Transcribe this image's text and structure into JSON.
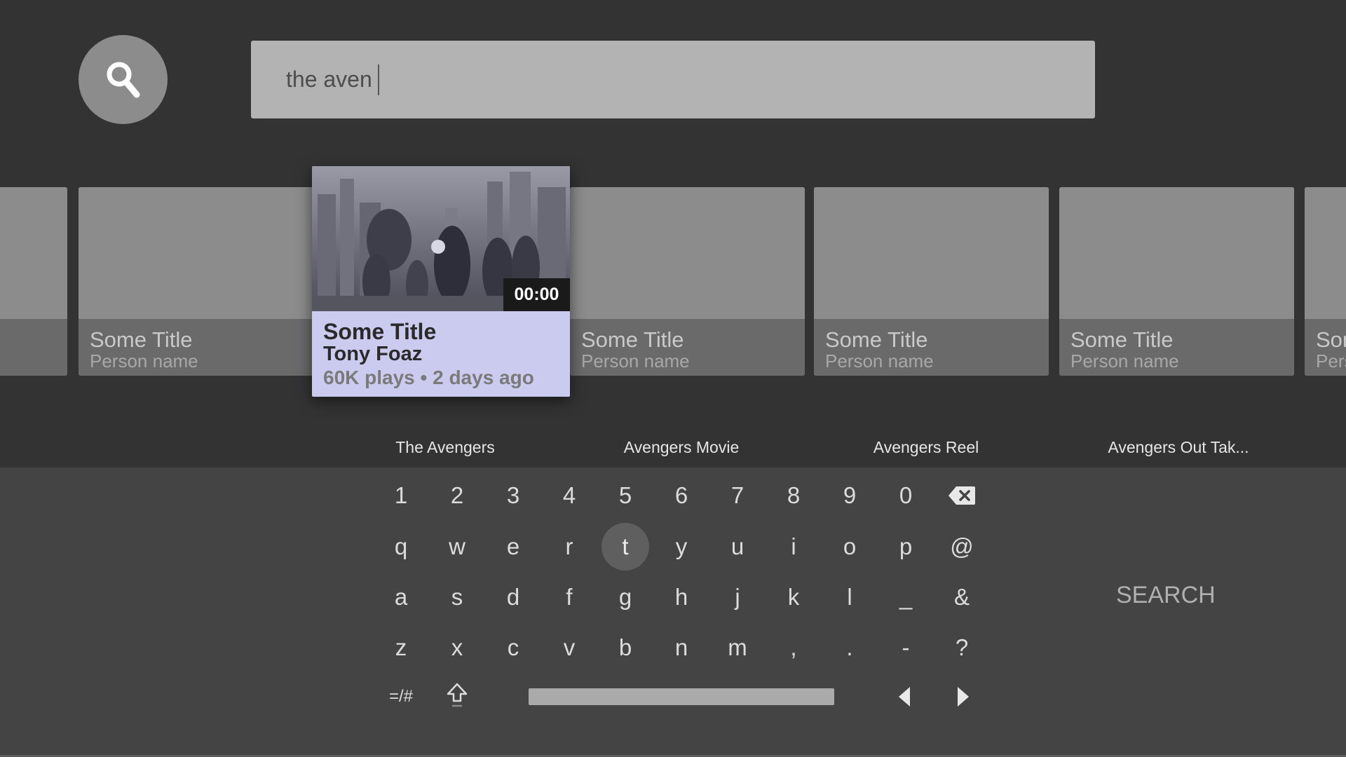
{
  "search": {
    "query": "the aven",
    "icon": "search-icon"
  },
  "results": [
    {
      "title": "",
      "person": ""
    },
    {
      "title": "Some Title",
      "person": "Person name"
    },
    {
      "title": "Some Title",
      "person": "Tony Foaz",
      "meta": "60K plays • 2 days ago",
      "duration": "00:00",
      "focused": true
    },
    {
      "title": "Some Title",
      "person": "Person name"
    },
    {
      "title": "Some Title",
      "person": "Person name"
    },
    {
      "title": "Some Title",
      "person": "Person name"
    },
    {
      "title": "Some Title",
      "person": "Person name"
    }
  ],
  "suggestions": [
    "The Avengers",
    "Avengers Movie",
    "Avengers Reel",
    "Avengers Out Tak..."
  ],
  "keyboard": {
    "row1": [
      "1",
      "2",
      "3",
      "4",
      "5",
      "6",
      "7",
      "8",
      "9",
      "0"
    ],
    "row2": [
      "q",
      "w",
      "e",
      "r",
      "t",
      "y",
      "u",
      "i",
      "o",
      "p",
      "@"
    ],
    "row3": [
      "a",
      "s",
      "d",
      "f",
      "g",
      "h",
      "j",
      "k",
      "l",
      "_",
      "&"
    ],
    "row4": [
      "z",
      "x",
      "c",
      "v",
      "b",
      "n",
      "m",
      ",",
      ".",
      "-",
      "?"
    ],
    "symbols_label": "=/#",
    "focused_key": "t",
    "search_label": "SEARCH"
  },
  "colors": {
    "background": "#333333",
    "keyboard": "#444444",
    "focused_card": "#cbcbf0"
  }
}
